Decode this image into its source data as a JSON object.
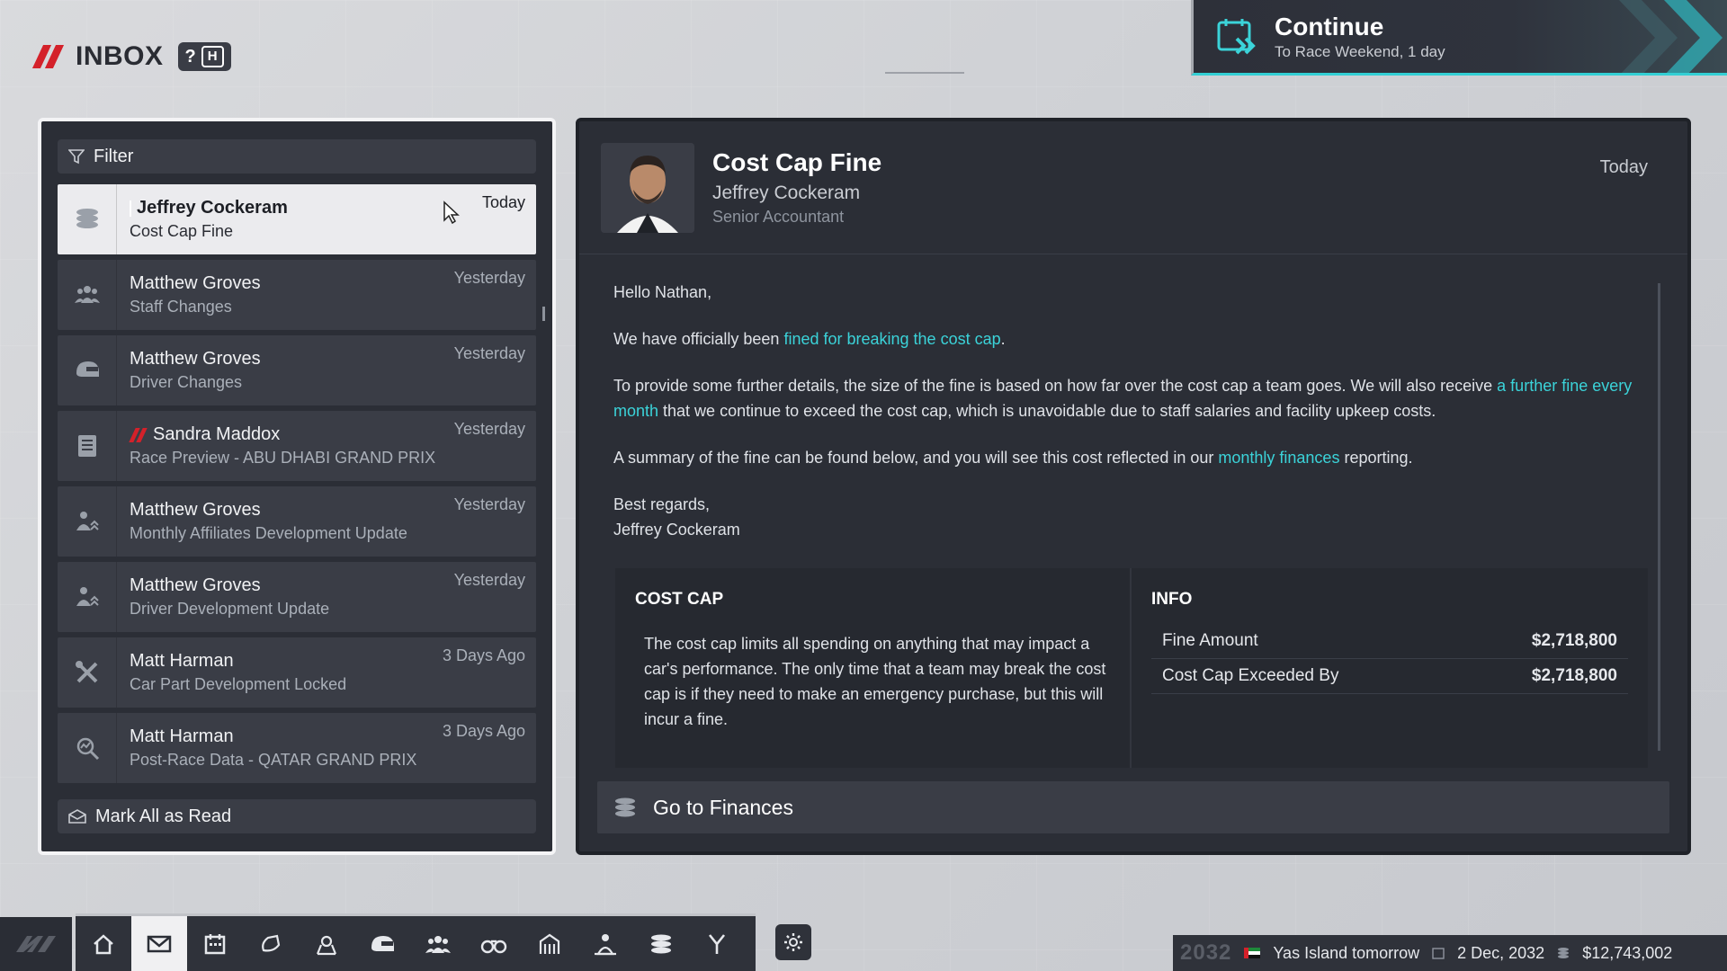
{
  "header": {
    "title": "INBOX",
    "help_key": "?",
    "hotkey": "H"
  },
  "continue": {
    "title": "Continue",
    "subtitle": "To Race Weekend, 1 day"
  },
  "filter": {
    "label": "Filter"
  },
  "messages": [
    {
      "sender": "Jeffrey Cockeram",
      "subject": "Cost Cap Fine",
      "when": "Today",
      "icon": "finance-stack-icon",
      "selected": true
    },
    {
      "sender": "Matthew Groves",
      "subject": "Staff Changes",
      "when": "Yesterday",
      "icon": "staff-people-icon"
    },
    {
      "sender": "Matthew Groves",
      "subject": "Driver Changes",
      "when": "Yesterday",
      "icon": "helmet-icon"
    },
    {
      "sender": "Sandra Maddox",
      "subject": "Race Preview - ABU DHABI GRAND PRIX",
      "when": "Yesterday",
      "icon": "document-icon",
      "badge": "f1-logo"
    },
    {
      "sender": "Matthew Groves",
      "subject": "Monthly Affiliates Development Update",
      "when": "Yesterday",
      "icon": "person-progress-icon"
    },
    {
      "sender": "Matthew Groves",
      "subject": "Driver Development Update",
      "when": "Yesterday",
      "icon": "person-progress-icon"
    },
    {
      "sender": "Matt Harman",
      "subject": "Car Part Development Locked",
      "when": "3 Days Ago",
      "icon": "tools-icon"
    },
    {
      "sender": "Matt Harman",
      "subject": "Post-Race Data - QATAR GRAND PRIX",
      "when": "3 Days Ago",
      "icon": "data-search-icon"
    }
  ],
  "mark_all": {
    "label": "Mark All as Read"
  },
  "mail": {
    "subject": "Cost Cap Fine",
    "from": "Jeffrey Cockeram",
    "role": "Senior Accountant",
    "date": "Today",
    "greeting": "Hello Nathan,",
    "p1_pre": "We have officially been ",
    "p1_link": "fined for breaking the cost cap",
    "p1_post": ".",
    "p2_pre": "To provide some further details, the size of the fine is based on how far over the cost cap a team goes. We will also receive ",
    "p2_link": "a further fine every month",
    "p2_post": " that we continue to exceed the cost cap, which is unavoidable due to staff salaries and facility upkeep costs.",
    "p3_pre": "A summary of the fine can be found below, and you will see this cost reflected in our ",
    "p3_link": "monthly finances",
    "p3_post": " reporting.",
    "signoff": "Best regards,",
    "signature": "Jeffrey Cockeram"
  },
  "summary": {
    "left_title": "COST CAP",
    "left_text": "The cost cap limits all spending on anything that may impact a car's performance. The only time that a team may break the cost cap is if they need to make an emergency purchase, but this will incur a fine.",
    "right_title": "INFO",
    "rows": [
      {
        "label": "Fine Amount",
        "value": "$2,718,800"
      },
      {
        "label": "Cost Cap Exceeded By",
        "value": "$2,718,800"
      }
    ]
  },
  "goto_button": {
    "label": "Go to Finances"
  },
  "nav": {
    "items": [
      "home-icon",
      "mail-icon",
      "calendar-icon",
      "car-part-icon",
      "hq-icon",
      "helmet-icon",
      "staff-icon",
      "scouting-binoculars-icon",
      "facilities-icon",
      "development-icon",
      "finance-icon",
      "strategy-icon"
    ],
    "active_index": 1
  },
  "status": {
    "year": "2032",
    "location": "Yas Island tomorrow",
    "date": "2 Dec, 2032",
    "balance": "$12,743,002"
  },
  "colors": {
    "accent": "#3bd3d9",
    "brand_red": "#d4212a",
    "panel": "#2b2e36"
  }
}
